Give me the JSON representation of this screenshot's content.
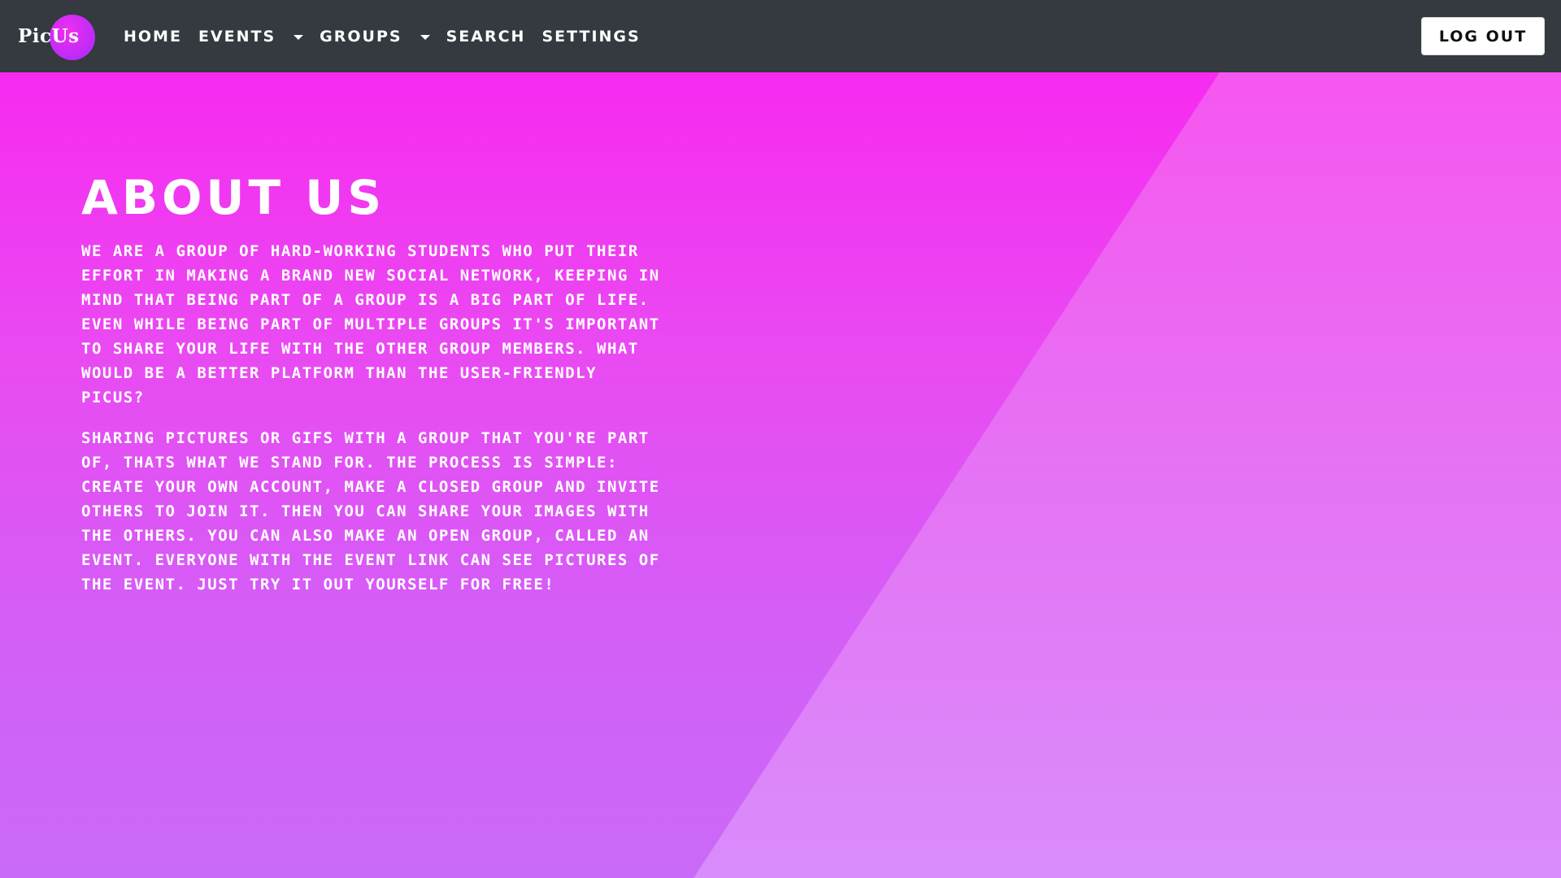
{
  "navbar": {
    "brand": "PicUs",
    "links": [
      {
        "label": "HOME",
        "dropdown": false
      },
      {
        "label": "EVENTS",
        "dropdown": true
      },
      {
        "label": "GROUPS",
        "dropdown": true
      },
      {
        "label": "SEARCH",
        "dropdown": false
      },
      {
        "label": "SETTINGS",
        "dropdown": false
      }
    ],
    "logout_label": "LOG OUT"
  },
  "about": {
    "title": "ABOUT US",
    "paragraph1": "WE ARE A GROUP OF HARD-WORKING STUDENTS WHO PUT THEIR EFFORT IN MAKING A BRAND NEW SOCIAL NETWORK, KEEPING IN MIND THAT BEING PART OF A GROUP IS A BIG PART OF LIFE. EVEN WHILE BEING PART OF MULTIPLE GROUPS IT'S IMPORTANT TO SHARE YOUR LIFE WITH THE OTHER GROUP MEMBERS. WHAT WOULD BE A BETTER PLATFORM THAN THE USER-FRIENDLY PICUS?",
    "paragraph2": "SHARING PICTURES OR GIFS WITH A GROUP THAT YOU'RE PART OF, THATS WHAT WE STAND FOR. THE PROCESS IS SIMPLE: CREATE YOUR OWN ACCOUNT, MAKE A CLOSED GROUP AND INVITE OTHERS TO JOIN IT. THEN YOU CAN SHARE YOUR IMAGES WITH THE OTHERS. YOU CAN ALSO MAKE AN OPEN GROUP, CALLED AN EVENT. EVERYONE WITH THE EVENT LINK CAN SEE PICTURES OF THE EVENT. JUST TRY IT OUT YOURSELF FOR FREE!"
  },
  "colors": {
    "navbar_bg": "#343a40",
    "hero_top": "#f72af0",
    "hero_bottom": "#c96af8",
    "text": "#ffffff"
  }
}
